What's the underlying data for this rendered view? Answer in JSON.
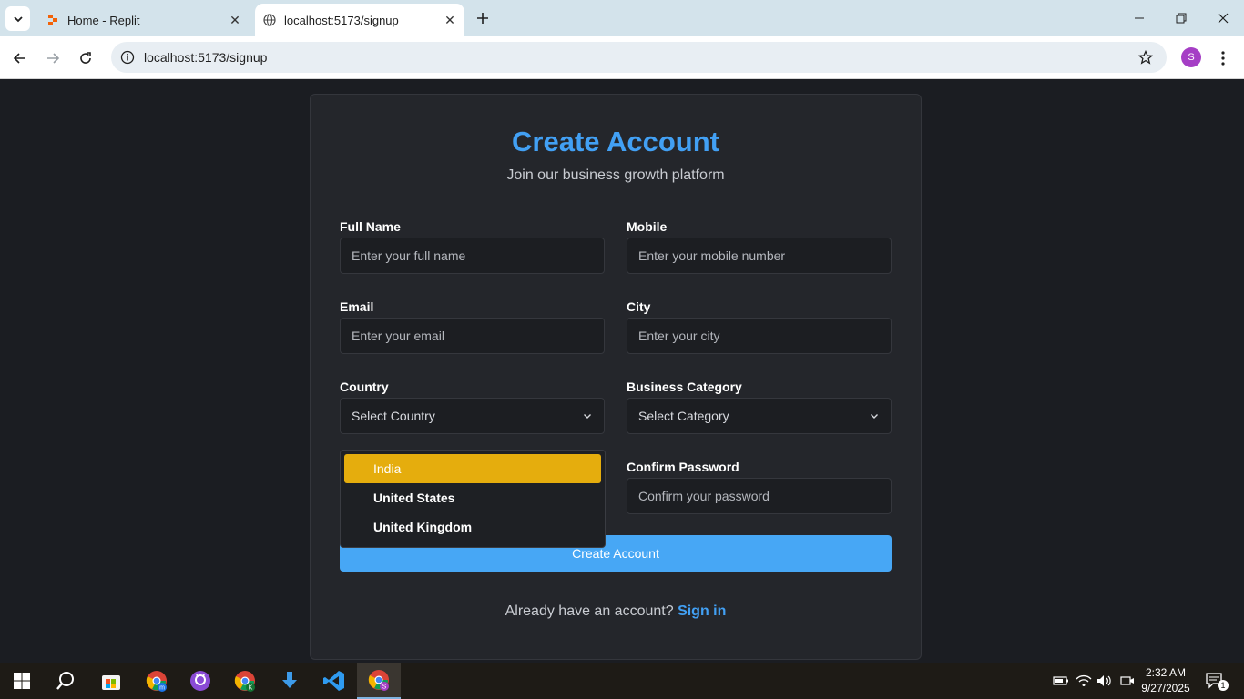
{
  "browser": {
    "tabs": [
      {
        "title": "Home - Replit",
        "active": false
      },
      {
        "title": "localhost:5173/signup",
        "active": true
      }
    ],
    "url": "localhost:5173/signup",
    "profile_initial": "S"
  },
  "form": {
    "title": "Create Account",
    "subtitle": "Join our business growth platform",
    "full_name": {
      "label": "Full Name",
      "placeholder": "Enter your full name"
    },
    "mobile": {
      "label": "Mobile",
      "placeholder": "Enter your mobile number"
    },
    "email": {
      "label": "Email",
      "placeholder": "Enter your email"
    },
    "city": {
      "label": "City",
      "placeholder": "Enter your city"
    },
    "country": {
      "label": "Country",
      "value": "Select Country",
      "options": [
        "India",
        "United States",
        "United Kingdom"
      ],
      "highlighted": "India"
    },
    "business_category": {
      "label": "Business Category",
      "value": "Select Category"
    },
    "confirm_password": {
      "label": "Confirm Password",
      "placeholder": "Confirm your password"
    },
    "submit_label": "Create Account",
    "signin_prompt": "Already have an account?",
    "signin_link": "Sign in"
  },
  "taskbar": {
    "time": "2:32 AM",
    "date": "9/27/2025",
    "notification_count": "1"
  },
  "colors": {
    "accent": "#42a0f4",
    "button": "#47a7f5",
    "highlight": "#e5ad0d",
    "background": "#1b1d22",
    "card": "#24262b"
  }
}
